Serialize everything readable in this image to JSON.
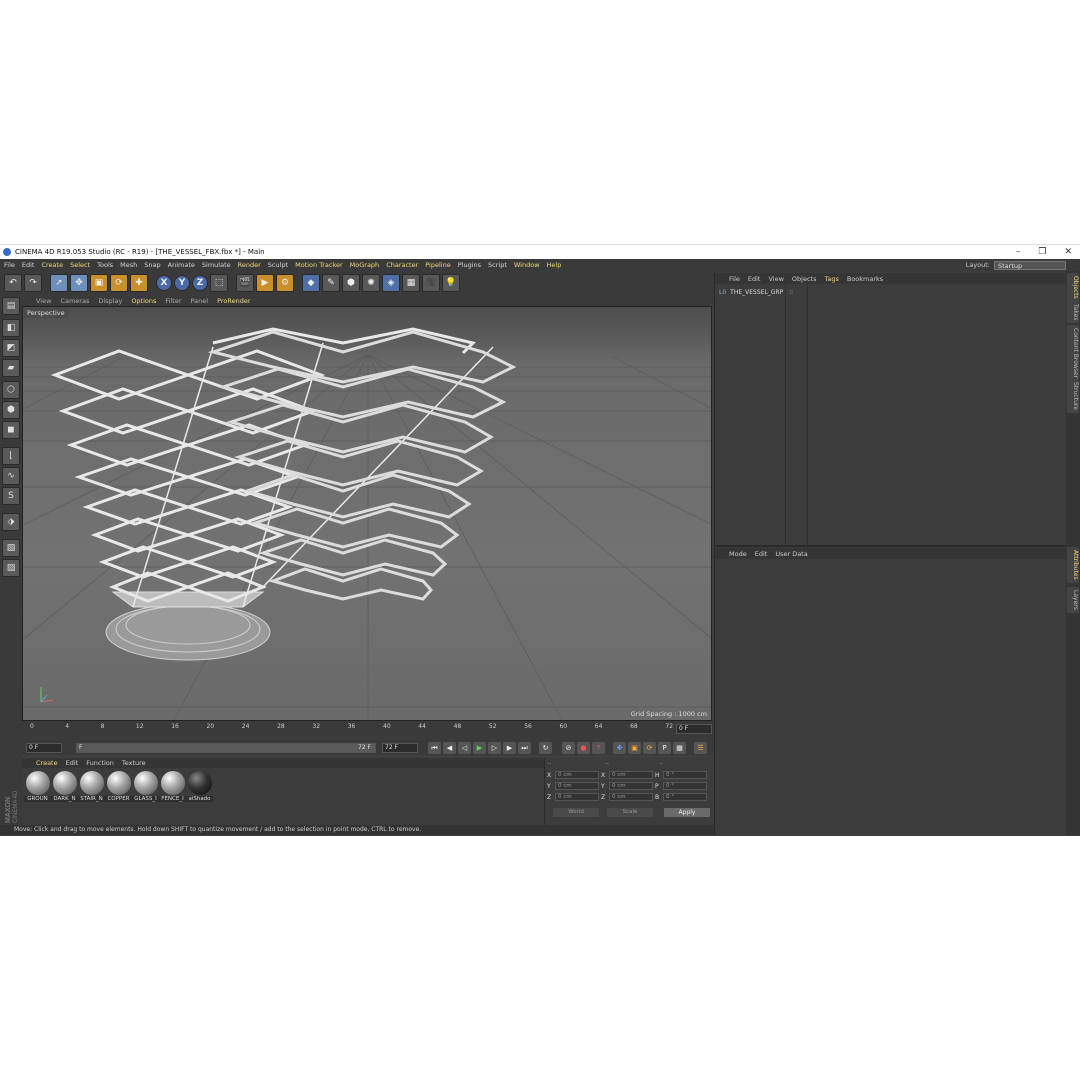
{
  "window": {
    "title": "CINEMA 4D R19.053 Studio (RC - R19) - [THE_VESSEL_FBX.fbx *] - Main",
    "min": "–",
    "max": "❐",
    "close": "✕"
  },
  "menubar": {
    "items": [
      "File",
      "Edit",
      "Create",
      "Select",
      "Tools",
      "Mesh",
      "Snap",
      "Animate",
      "Simulate",
      "Render",
      "Sculpt",
      "Motion Tracker",
      "MoGraph",
      "Character",
      "Pipeline",
      "Plugins",
      "Script",
      "Window",
      "Help"
    ],
    "layout_label": "Layout:",
    "layout_value": "Startup"
  },
  "viewport": {
    "menu": [
      "View",
      "Cameras",
      "Display",
      "Options",
      "Filter",
      "Panel",
      "ProRender"
    ],
    "label": "Perspective",
    "grid_spacing": "Grid Spacing : 1000 cm"
  },
  "timeline": {
    "ticks": [
      "0",
      "4",
      "8",
      "12",
      "16",
      "20",
      "24",
      "28",
      "32",
      "36",
      "40",
      "44",
      "48",
      "52",
      "56",
      "60",
      "64",
      "68",
      "72"
    ],
    "current": "0 F"
  },
  "transport": {
    "start": "0 F",
    "range_start": "F",
    "range_end": "72 F",
    "end": "72 F"
  },
  "materials": {
    "menu": [
      "Create",
      "Edit",
      "Function",
      "Texture"
    ],
    "items": [
      {
        "name": "GROUN"
      },
      {
        "name": "DARK_N"
      },
      {
        "name": "STAIR_N"
      },
      {
        "name": "COPPER"
      },
      {
        "name": "GLASS_I"
      },
      {
        "name": "FENCE_I"
      },
      {
        "name": "aiShado"
      }
    ]
  },
  "coordinates": {
    "headers": [
      "--",
      "--",
      "--"
    ],
    "rows": [
      {
        "a": "X",
        "av": "0 cm",
        "b": "X",
        "bv": "0 cm",
        "c": "H",
        "cv": "0 °"
      },
      {
        "a": "Y",
        "av": "0 cm",
        "b": "Y",
        "bv": "0 cm",
        "c": "P",
        "cv": "0 °"
      },
      {
        "a": "Z",
        "av": "0 cm",
        "b": "Z",
        "bv": "0 cm",
        "c": "B",
        "cv": "0 °"
      }
    ],
    "world": "World",
    "scale": "Scale",
    "apply": "Apply"
  },
  "status": "Move: Click and drag to move elements. Hold down SHIFT to quantize movement / add to the selection in point mode, CTRL to remove.",
  "objects": {
    "menu": [
      "File",
      "Edit",
      "View",
      "Objects",
      "Tags",
      "Bookmarks"
    ],
    "items": [
      {
        "name": "THE_VESSEL_GRP",
        "icon": "L0"
      }
    ]
  },
  "attributes": {
    "menu": [
      "Mode",
      "Edit",
      "User Data"
    ]
  },
  "side_tabs": [
    "Objects",
    "Takes",
    "Content Browser",
    "Structure",
    "Attributes",
    "Layers"
  ],
  "brand": {
    "line1": "MAXON",
    "line2": "CINEMA 4D"
  }
}
